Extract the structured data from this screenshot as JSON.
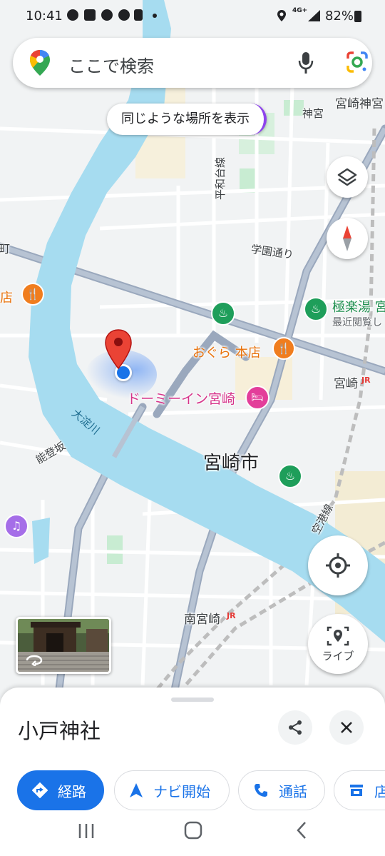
{
  "status_bar": {
    "time": "10:41",
    "network": "4G+",
    "battery": "82%"
  },
  "search": {
    "placeholder": "ここで検索"
  },
  "similar_places_chip": "同じような場所を表示",
  "map_labels": {
    "miyazaki_jingu_station": "宮崎神宮",
    "jingu": "神宮",
    "hirawadai_line": "平和台線",
    "gakuen_dori": "学園通り",
    "machi": "町",
    "ten": "店",
    "gokurakuyu": "極楽湯 宮",
    "recently_viewed": "最近閲覧し",
    "ogura": "おぐら 本店",
    "miyazaki_station": "宮崎",
    "dormy_inn": "ドーミーイン宮崎",
    "oyodo_river": "大淀川",
    "notozaka": "能登坂",
    "miyazaki_city": "宮崎市",
    "airport_line": "空港線",
    "minami_miyazaki": "南宮崎",
    "jr": "JR"
  },
  "live_button": "ライブ",
  "place": {
    "title": "小戸神社"
  },
  "actions": [
    {
      "label": "経路",
      "icon": "directions-icon"
    },
    {
      "label": "ナビ開始",
      "icon": "navigation-icon"
    },
    {
      "label": "通話",
      "icon": "phone-icon"
    },
    {
      "label": "店",
      "icon": "store-icon"
    }
  ],
  "colors": {
    "water": "#a6dcf0",
    "road": "#ffffff",
    "land": "#f1f3f4",
    "park": "#c8ecd2",
    "accent": "#1a73e8",
    "pin": "#ea4335",
    "food": "#f07d1e",
    "hotel": "#e33e9a",
    "spa": "#1e9e5a",
    "music": "#a56ee8"
  }
}
